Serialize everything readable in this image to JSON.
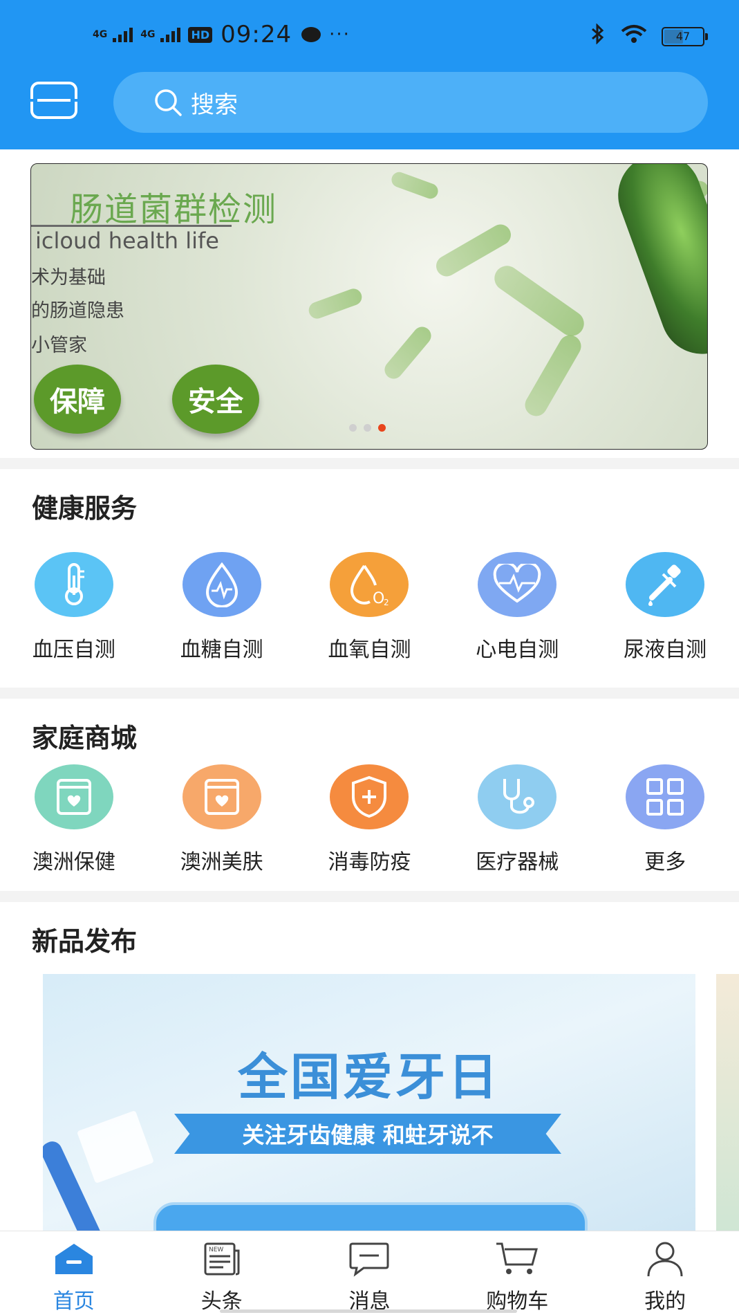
{
  "status_bar": {
    "network1": "4G",
    "network2": "4G",
    "hd": "HD",
    "time": "09:24",
    "more": "···",
    "battery": "47"
  },
  "header": {
    "search_placeholder": "搜索"
  },
  "banner": {
    "title": "肠道菌群检测",
    "subtitle": "icloud health life",
    "lines": [
      "术为基础",
      "的肠道隐患",
      "小管家"
    ],
    "badges": [
      "保障",
      "安全"
    ],
    "page_count": 3,
    "active_page": 3
  },
  "health_services": {
    "title": "健康服务",
    "items": [
      {
        "label": "血压自测",
        "icon": "thermometer-icon",
        "color": "#5BC4F5"
      },
      {
        "label": "血糖自测",
        "icon": "blood-drop-icon",
        "color": "#6FA2F2"
      },
      {
        "label": "血氧自测",
        "icon": "oxygen-drop-icon",
        "color": "#F5A03A"
      },
      {
        "label": "心电自测",
        "icon": "heart-rate-icon",
        "color": "#7FA8F2"
      },
      {
        "label": "尿液自测",
        "icon": "dropper-icon",
        "color": "#4FB7F2"
      }
    ]
  },
  "home_mall": {
    "title": "家庭商城",
    "items": [
      {
        "label": "澳洲保健",
        "icon": "health-box-icon",
        "color": "#7FD6BE"
      },
      {
        "label": "澳洲美肤",
        "icon": "beauty-box-icon",
        "color": "#F7A86A"
      },
      {
        "label": "消毒防疫",
        "icon": "shield-plus-icon",
        "color": "#F58B3F"
      },
      {
        "label": "医疗器械",
        "icon": "stethoscope-icon",
        "color": "#8FCDF0"
      },
      {
        "label": "更多",
        "icon": "grid-icon",
        "color": "#8AA6F2"
      }
    ]
  },
  "new_products": {
    "title": "新品发布",
    "promo_title": "全国爱牙日",
    "promo_slogan": "关注牙齿健康  和蛀牙说不"
  },
  "bottom_nav": {
    "items": [
      {
        "label": "首页",
        "icon": "home-icon",
        "active": true
      },
      {
        "label": "头条",
        "icon": "news-icon",
        "active": false
      },
      {
        "label": "消息",
        "icon": "message-icon",
        "active": false
      },
      {
        "label": "购物车",
        "icon": "cart-icon",
        "active": false
      },
      {
        "label": "我的",
        "icon": "user-icon",
        "active": false
      }
    ],
    "active_color": "#2A86E0"
  },
  "colors": {
    "primary": "#2196F3",
    "search_bg": "#4DB0F8",
    "page_indicator_active": "#E8451C"
  }
}
